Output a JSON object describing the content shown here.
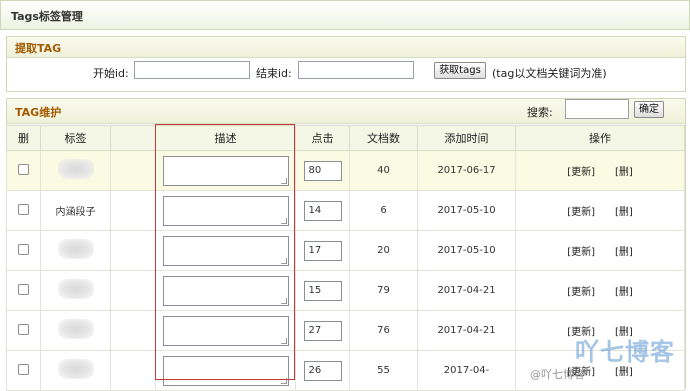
{
  "title": "Tags标签管理",
  "extract": {
    "header": "提取TAG",
    "start_label": "开始id:",
    "end_label": "结束id:",
    "button": "获取tags",
    "note": "(tag以文档关键词为准)"
  },
  "maintain": {
    "header": "TAG维护",
    "search_label": "搜索:",
    "search_button": "确定"
  },
  "columns": [
    "删",
    "标签",
    "",
    "描述",
    "点击",
    "文档数",
    "添加时间",
    "操作"
  ],
  "rows": [
    {
      "tag": "",
      "clicks": "80",
      "docs": "40",
      "date": "2017-06-17"
    },
    {
      "tag": "内涵段子",
      "clicks": "14",
      "docs": "6",
      "date": "2017-05-10"
    },
    {
      "tag": "",
      "clicks": "17",
      "docs": "20",
      "date": "2017-05-10"
    },
    {
      "tag": "",
      "clicks": "15",
      "docs": "79",
      "date": "2017-04-21"
    },
    {
      "tag": "",
      "clicks": "27",
      "docs": "76",
      "date": "2017-04-21"
    },
    {
      "tag": "",
      "clicks": "26",
      "docs": "55",
      "date": "2017-04-"
    }
  ],
  "actions": {
    "update": "[更新]",
    "delete": "[删]"
  },
  "watermark": {
    "main": "吖七博客",
    "sub": "@吖七博客"
  }
}
